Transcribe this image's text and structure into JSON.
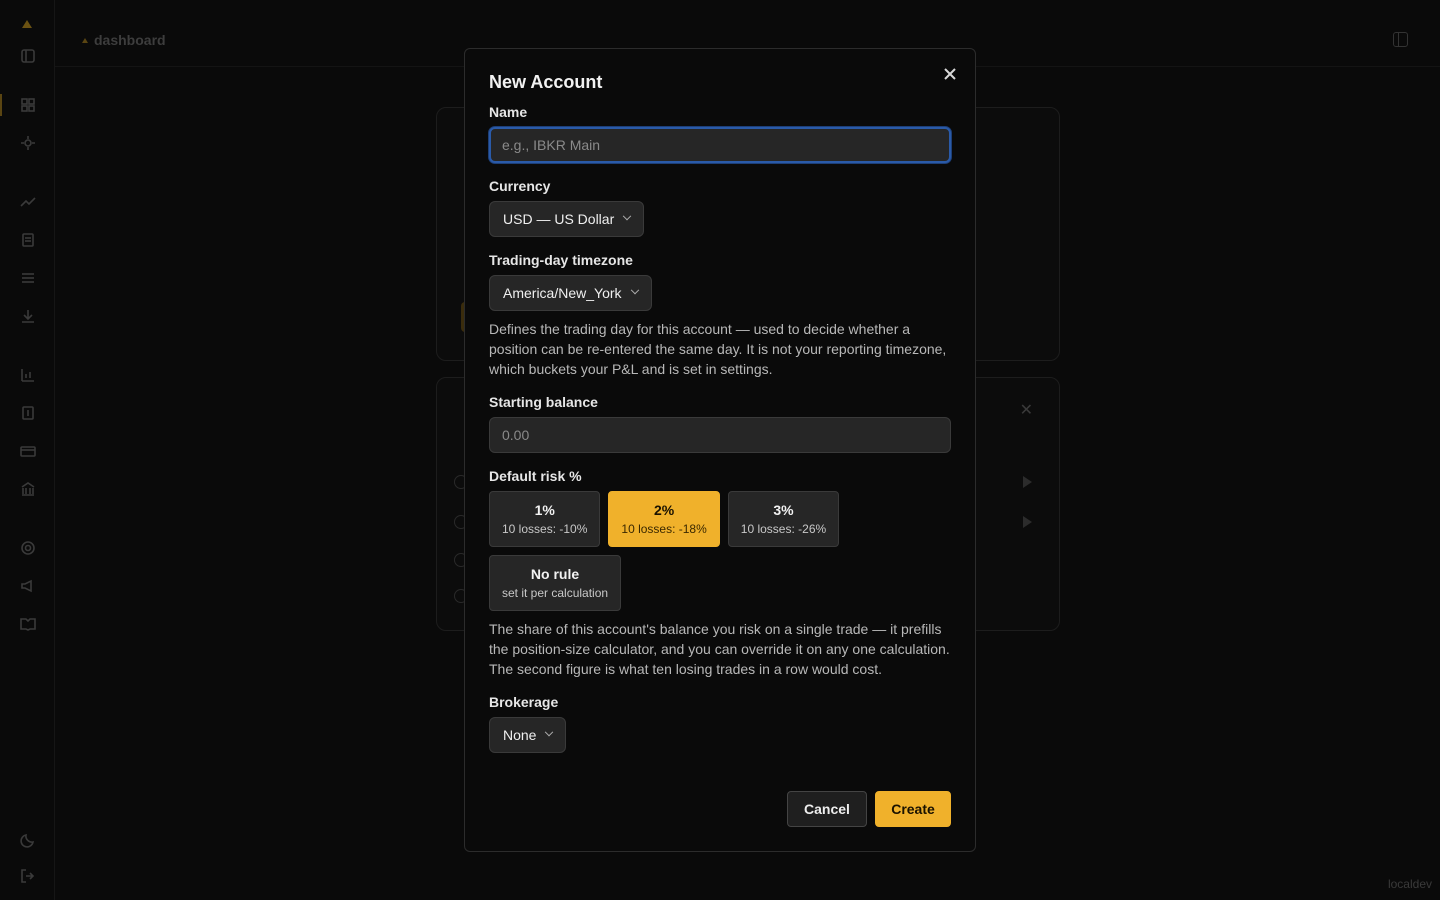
{
  "header": {
    "breadcrumb": "dashboard"
  },
  "footer_tag": "localdev",
  "modal": {
    "title": "New Account",
    "name": {
      "label": "Name",
      "placeholder": "e.g., IBKR Main",
      "value": ""
    },
    "currency": {
      "label": "Currency",
      "selected": "USD — US Dollar"
    },
    "timezone": {
      "label": "Trading-day timezone",
      "selected": "America/New_York",
      "help": "Defines the trading day for this account — used to decide whether a position can be re-entered the same day. It is not your reporting timezone, which buckets your P&L and is set in settings."
    },
    "starting_balance": {
      "label": "Starting balance",
      "placeholder": "0.00",
      "value": ""
    },
    "default_risk": {
      "label": "Default risk %",
      "options": [
        {
          "value": "1%",
          "sub": "10 losses: -10%",
          "selected": false
        },
        {
          "value": "2%",
          "sub": "10 losses: -18%",
          "selected": true
        },
        {
          "value": "3%",
          "sub": "10 losses: -26%",
          "selected": false
        },
        {
          "value": "No rule",
          "sub": "set it per calculation",
          "selected": false
        }
      ],
      "help": "The share of this account's balance you risk on a single trade — it prefills the position-size calculator, and you can override it on any one calculation. The second figure is what ten losing trades in a row would cost."
    },
    "brokerage": {
      "label": "Brokerage",
      "selected": "None"
    },
    "cancel_label": "Cancel",
    "create_label": "Create"
  },
  "colors": {
    "accent": "#f0b12b",
    "focus_ring": "#2a5aa8",
    "background": "#0a0a0a"
  },
  "icons": [
    "logo-icon",
    "sidebar-toggle-icon",
    "dashboard-icon",
    "calculator-icon",
    "trending-icon",
    "clipboard-icon",
    "list-icon",
    "download-icon",
    "bar-chart-icon",
    "document-icon",
    "card-icon",
    "bank-icon",
    "settings-icon",
    "megaphone-icon",
    "book-icon",
    "moon-icon",
    "logout-icon",
    "close-icon",
    "chevron-down-icon"
  ]
}
